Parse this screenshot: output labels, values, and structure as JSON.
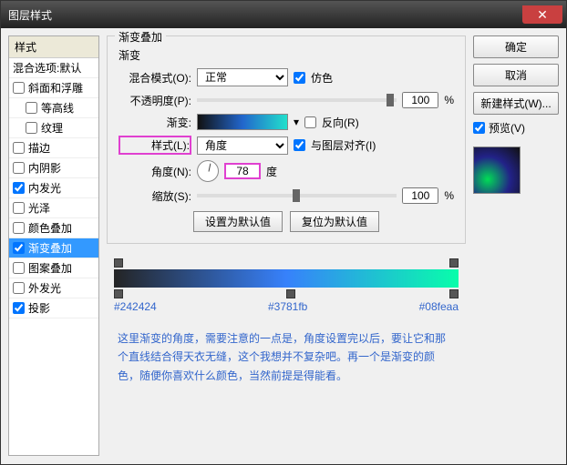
{
  "title": "图层样式",
  "left": {
    "header": "样式",
    "blendDefault": "混合选项:默认",
    "items": [
      {
        "label": "斜面和浮雕",
        "checked": false,
        "indent": false
      },
      {
        "label": "等高线",
        "checked": false,
        "indent": true
      },
      {
        "label": "纹理",
        "checked": false,
        "indent": true
      },
      {
        "label": "描边",
        "checked": false,
        "indent": false
      },
      {
        "label": "内阴影",
        "checked": false,
        "indent": false
      },
      {
        "label": "内发光",
        "checked": true,
        "indent": false
      },
      {
        "label": "光泽",
        "checked": false,
        "indent": false
      },
      {
        "label": "颜色叠加",
        "checked": false,
        "indent": false
      },
      {
        "label": "渐变叠加",
        "checked": true,
        "indent": false,
        "selected": true
      },
      {
        "label": "图案叠加",
        "checked": false,
        "indent": false
      },
      {
        "label": "外发光",
        "checked": false,
        "indent": false
      },
      {
        "label": "投影",
        "checked": true,
        "indent": false
      }
    ]
  },
  "mid": {
    "groupTitle": "渐变叠加",
    "subTitle": "渐变",
    "blendModeLabel": "混合模式(O):",
    "blendModeValue": "正常",
    "ditherLabel": "仿色",
    "opacityLabel": "不透明度(P):",
    "opacityValue": "100",
    "pct": "%",
    "gradientLabel": "渐变:",
    "reverseLabel": "反向(R)",
    "styleLabel": "样式(L):",
    "styleValue": "角度",
    "alignLabel": "与图层对齐(I)",
    "angleLabel": "角度(N):",
    "angleValue": "78",
    "degree": "度",
    "scaleLabel": "缩放(S):",
    "scaleValue": "100",
    "setDefault": "设置为默认值",
    "resetDefault": "复位为默认值",
    "stops": {
      "c1": "#242424",
      "c2": "#3781fb",
      "c3": "#08feaa"
    },
    "note": "这里渐变的角度，需要注意的一点是，角度设置完以后，要让它和那个直线结合得天衣无缝，这个我想并不复杂吧。再一个是渐变的颜色，随便你喜欢什么颜色，当然前提是得能看。"
  },
  "right": {
    "ok": "确定",
    "cancel": "取消",
    "newStyle": "新建样式(W)...",
    "previewLabel": "预览(V)"
  }
}
